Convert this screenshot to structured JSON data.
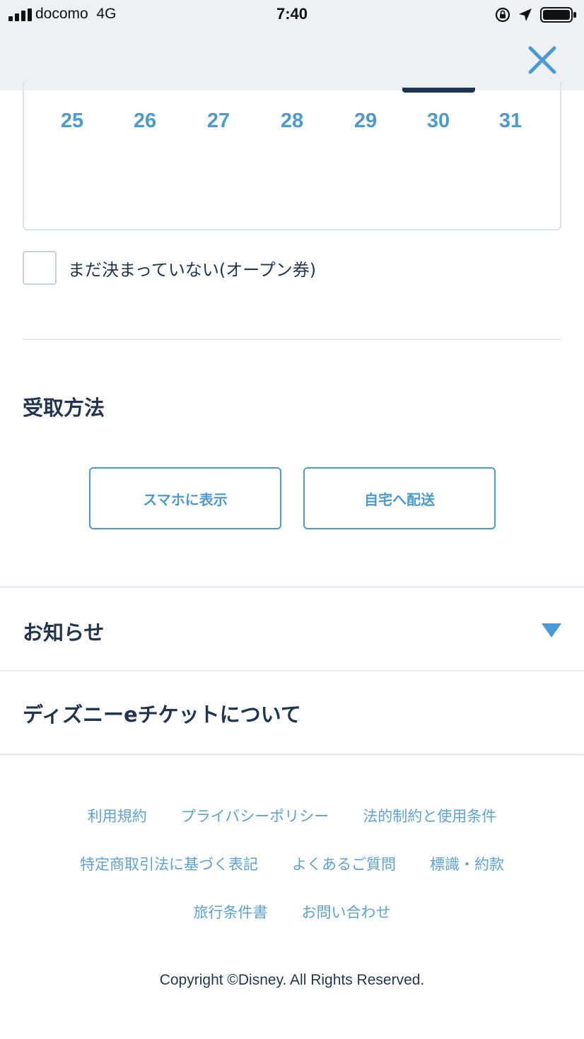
{
  "status_bar": {
    "carrier": "docomo",
    "network": "4G",
    "time": "7:40"
  },
  "header": {
    "close_icon": "close-icon"
  },
  "calendar": {
    "days": [
      "25",
      "26",
      "27",
      "28",
      "29",
      "30",
      "31"
    ],
    "selected_day": "30"
  },
  "open_ticket": {
    "label": "まだ決まっていない(オープン券)",
    "checked": false
  },
  "receive_method": {
    "title": "受取方法",
    "options": [
      "スマホに表示",
      "自宅へ配送"
    ]
  },
  "sections": {
    "notice": "お知らせ",
    "about": "ディズニーeチケットについて"
  },
  "footer": {
    "links_row1": [
      "利用規約",
      "プライバシーポリシー",
      "法的制約と使用条件"
    ],
    "links_row2": [
      "特定商取引法に基づく表記",
      "よくあるご質問",
      "標識・約款"
    ],
    "links_row3": [
      "旅行条件書",
      "お問い合わせ"
    ],
    "copyright": "Copyright ©Disney. All Rights Reserved."
  },
  "colors": {
    "accent": "#4a9ad4",
    "text": "#1f3552",
    "header_bg": "#eef1f4"
  }
}
